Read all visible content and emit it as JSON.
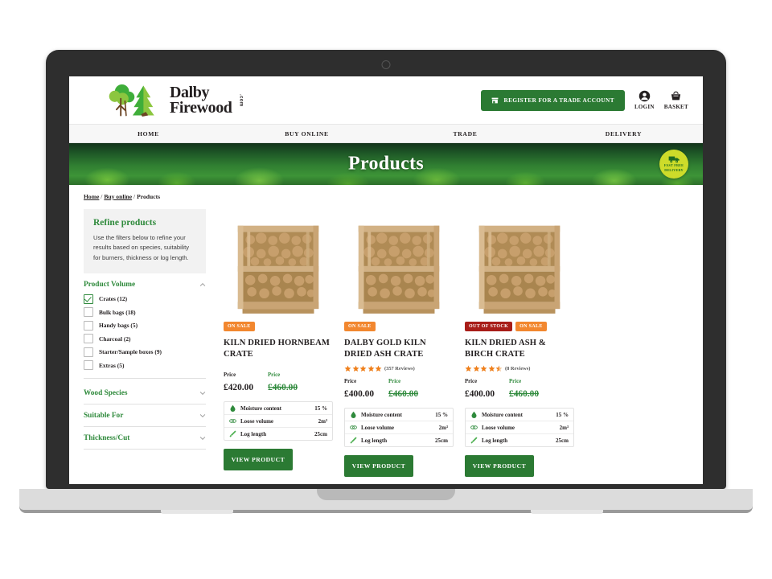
{
  "brand": {
    "line1": "Dalby",
    "line2": "Firewood",
    "suffix": ".com",
    "logo_icon": "trees-logo-icon"
  },
  "header": {
    "trade_button": "REGISTER FOR A TRADE ACCOUNT",
    "trade_icon": "storefront-icon",
    "login_label": "LOGIN",
    "login_icon": "user-icon",
    "basket_label": "BASKET",
    "basket_icon": "basket-icon"
  },
  "nav": {
    "items": [
      {
        "label": "HOME"
      },
      {
        "label": "BUY ONLINE"
      },
      {
        "label": "TRADE"
      },
      {
        "label": "DELIVERY"
      }
    ]
  },
  "hero": {
    "title": "Products",
    "badge_line1": "FAST FREE",
    "badge_line2": "DELIVERY",
    "badge_icon": "delivery-truck-icon",
    "badge_color": "#cddc2a"
  },
  "breadcrumb": {
    "home": "Home",
    "sep1": " / ",
    "buy_online": "Buy online",
    "sep2": " / ",
    "current": "Products"
  },
  "sidebar": {
    "refine_title": "Refine products",
    "refine_text": "Use the filters below to refine your results based on species, suitability for burners, thickness or log length.",
    "groups": [
      {
        "title": "Product Volume",
        "expanded": true,
        "chevron": "chevron-up-icon",
        "options": [
          {
            "label": "Crates (12)",
            "checked": true
          },
          {
            "label": "Bulk bags (18)",
            "checked": false
          },
          {
            "label": "Handy bags (5)",
            "checked": false
          },
          {
            "label": "Charcoal (2)",
            "checked": false
          },
          {
            "label": "Starter/Sample boxes (9)",
            "checked": false
          },
          {
            "label": "Extras (5)",
            "checked": false
          }
        ]
      },
      {
        "title": "Wood Species",
        "expanded": false,
        "chevron": "chevron-down-icon"
      },
      {
        "title": "Suitable For",
        "expanded": false,
        "chevron": "chevron-down-icon"
      },
      {
        "title": "Thickness/Cut",
        "expanded": false,
        "chevron": "chevron-down-icon"
      }
    ]
  },
  "spec_labels": {
    "moisture": "Moisture content",
    "volume": "Loose volume",
    "length": "Log length",
    "moisture_icon": "water-drop-icon",
    "volume_icon": "logs-icon",
    "length_icon": "ruler-icon"
  },
  "price_labels": {
    "current": "Price",
    "was": "Price"
  },
  "view_product_label": "VIEW PRODUCT",
  "products": [
    {
      "title": "KILN DRIED HORNBEAM CRATE",
      "badges": [
        {
          "text": "ON SALE",
          "kind": "sale"
        }
      ],
      "rating": null,
      "reviews": null,
      "price": "£420.00",
      "old_price": "£460.00",
      "moisture": "15 %",
      "volume": "2m³",
      "length": "25cm",
      "image_icon": "firewood-crate-image"
    },
    {
      "title": "DALBY GOLD KILN DRIED ASH CRATE",
      "badges": [
        {
          "text": "ON SALE",
          "kind": "sale"
        }
      ],
      "rating": 5,
      "reviews": "(357 Reviews)",
      "price": "£400.00",
      "old_price": "£460.00",
      "moisture": "15 %",
      "volume": "2m³",
      "length": "25cm",
      "image_icon": "firewood-crate-image"
    },
    {
      "title": "KILN DRIED ASH & BIRCH CRATE",
      "badges": [
        {
          "text": "OUT OF STOCK",
          "kind": "oos"
        },
        {
          "text": "ON SALE",
          "kind": "sale"
        }
      ],
      "rating": 4.5,
      "reviews": "(8 Reviews)",
      "price": "£400.00",
      "old_price": "£460.00",
      "moisture": "15 %",
      "volume": "2m³",
      "length": "25cm",
      "image_icon": "firewood-crate-image"
    }
  ],
  "colors": {
    "brand_green": "#2b7a33",
    "heading_green": "#2f8a3c",
    "sale_orange": "#f2872f",
    "out_of_stock_red": "#a81d18",
    "star_orange": "#ef7f1a"
  }
}
